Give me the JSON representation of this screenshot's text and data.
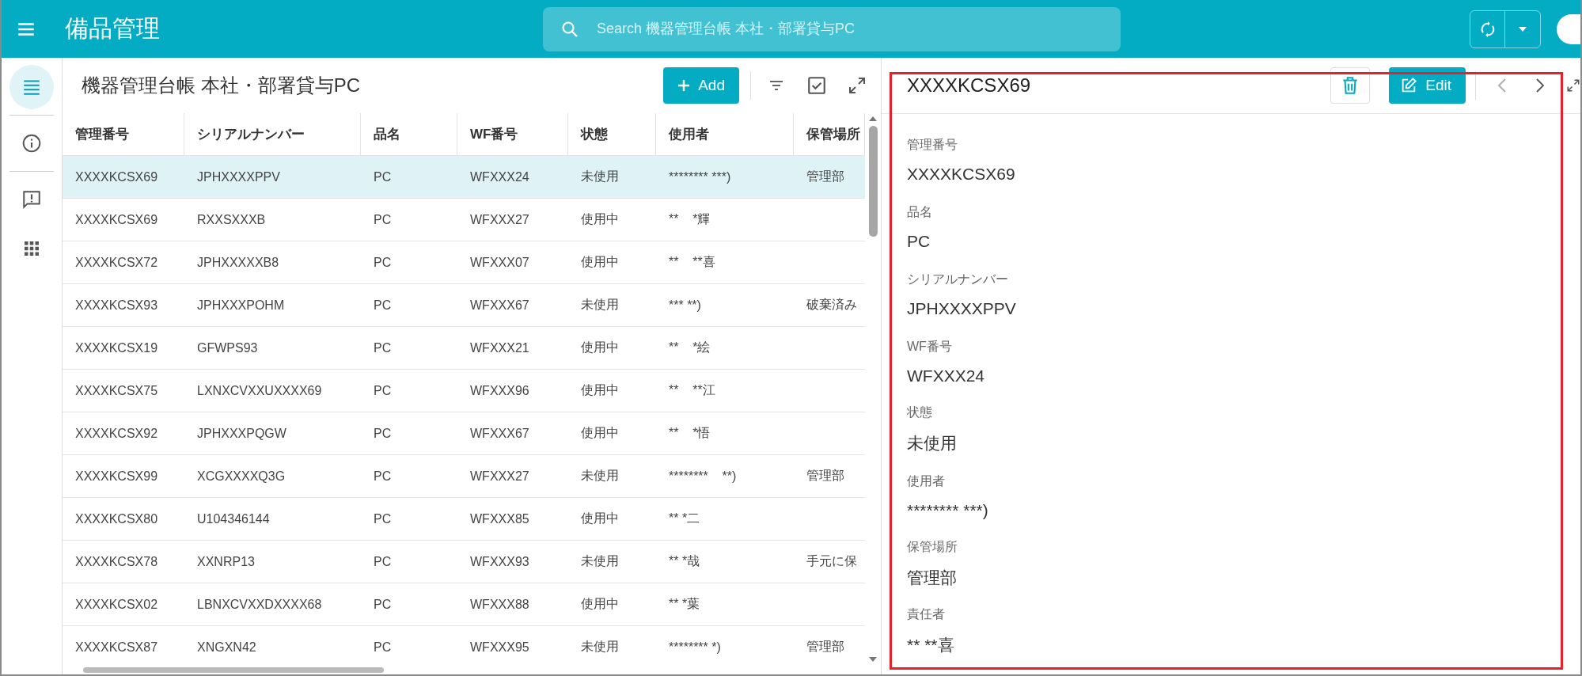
{
  "app_bar": {
    "title": "備品管理",
    "search": {
      "placeholder": "Search 機器管理台帳 本社・部署貸与PC"
    }
  },
  "rail": [
    {
      "kind": "list",
      "selected": true
    },
    {
      "kind": "info",
      "selected": false
    },
    {
      "kind": "feedback",
      "selected": false
    },
    {
      "kind": "apps",
      "selected": false
    }
  ],
  "list_panel": {
    "title": "機器管理台帳 本社・部署貸与PC",
    "add_button": "Add",
    "columns": [
      "管理番号",
      "シリアルナンバー",
      "品名",
      "WF番号",
      "状態",
      "使用者",
      "保管場所"
    ],
    "rows": [
      {
        "selected": true,
        "cells": [
          "XXXXKCSX69",
          "JPHXXXXPPV",
          "PC",
          "WFXXX24",
          "未使用",
          "******** ***)",
          "管理部"
        ]
      },
      {
        "selected": false,
        "cells": [
          "XXXXKCSX69",
          "RXXSXXXB",
          "PC",
          "WFXXX27",
          "使用中",
          "**    *輝",
          ""
        ]
      },
      {
        "selected": false,
        "cells": [
          "XXXXKCSX72",
          "JPHXXXXXB8",
          "PC",
          "WFXXX07",
          "使用中",
          "**    **喜",
          ""
        ]
      },
      {
        "selected": false,
        "cells": [
          "XXXXKCSX93",
          "JPHXXXPOHM",
          "PC",
          "WFXXX67",
          "未使用",
          "*** **)",
          "破棄済み"
        ]
      },
      {
        "selected": false,
        "cells": [
          "XXXXKCSX19",
          "GFWPS93",
          "PC",
          "WFXXX21",
          "使用中",
          "**    *絵",
          ""
        ]
      },
      {
        "selected": false,
        "cells": [
          "XXXXKCSX75",
          "LXNXCVXXUXXXX69",
          "PC",
          "WFXXX96",
          "使用中",
          "**    **江",
          ""
        ]
      },
      {
        "selected": false,
        "cells": [
          "XXXXKCSX92",
          "JPHXXXPQGW",
          "PC",
          "WFXXX67",
          "使用中",
          "**    *悟",
          ""
        ]
      },
      {
        "selected": false,
        "cells": [
          "XXXXKCSX99",
          "XCGXXXXQ3G",
          "PC",
          "WFXXX27",
          "未使用",
          "********    **)",
          "管理部"
        ]
      },
      {
        "selected": false,
        "cells": [
          "XXXXKCSX80",
          "U104346144",
          "PC",
          "WFXXX85",
          "使用中",
          "** *二",
          ""
        ]
      },
      {
        "selected": false,
        "cells": [
          "XXXXKCSX78",
          "XXNRP13",
          "PC",
          "WFXXX93",
          "未使用",
          "** *哉",
          "手元に保"
        ]
      },
      {
        "selected": false,
        "cells": [
          "XXXXKCSX02",
          "LBNXCVXXDXXXX68",
          "PC",
          "WFXXX88",
          "使用中",
          "** *葉",
          ""
        ]
      },
      {
        "selected": false,
        "cells": [
          "XXXXKCSX87",
          "XNGXN42",
          "PC",
          "WFXXX95",
          "未使用",
          "******** *)",
          "管理部"
        ]
      }
    ]
  },
  "detail_panel": {
    "title": "XXXXKCSX69",
    "edit_button": "Edit",
    "fields": [
      {
        "label": "管理番号",
        "value": "XXXXKCSX69"
      },
      {
        "label": "品名",
        "value": "PC"
      },
      {
        "label": "シリアルナンバー",
        "value": "JPHXXXXPPV"
      },
      {
        "label": "WF番号",
        "value": "WFXXX24"
      },
      {
        "label": "状態",
        "value": "未使用"
      },
      {
        "label": "使用者",
        "value": "******** ***)"
      },
      {
        "label": "保管場所",
        "value": "管理部"
      },
      {
        "label": "責任者",
        "value": "** **喜"
      }
    ]
  }
}
